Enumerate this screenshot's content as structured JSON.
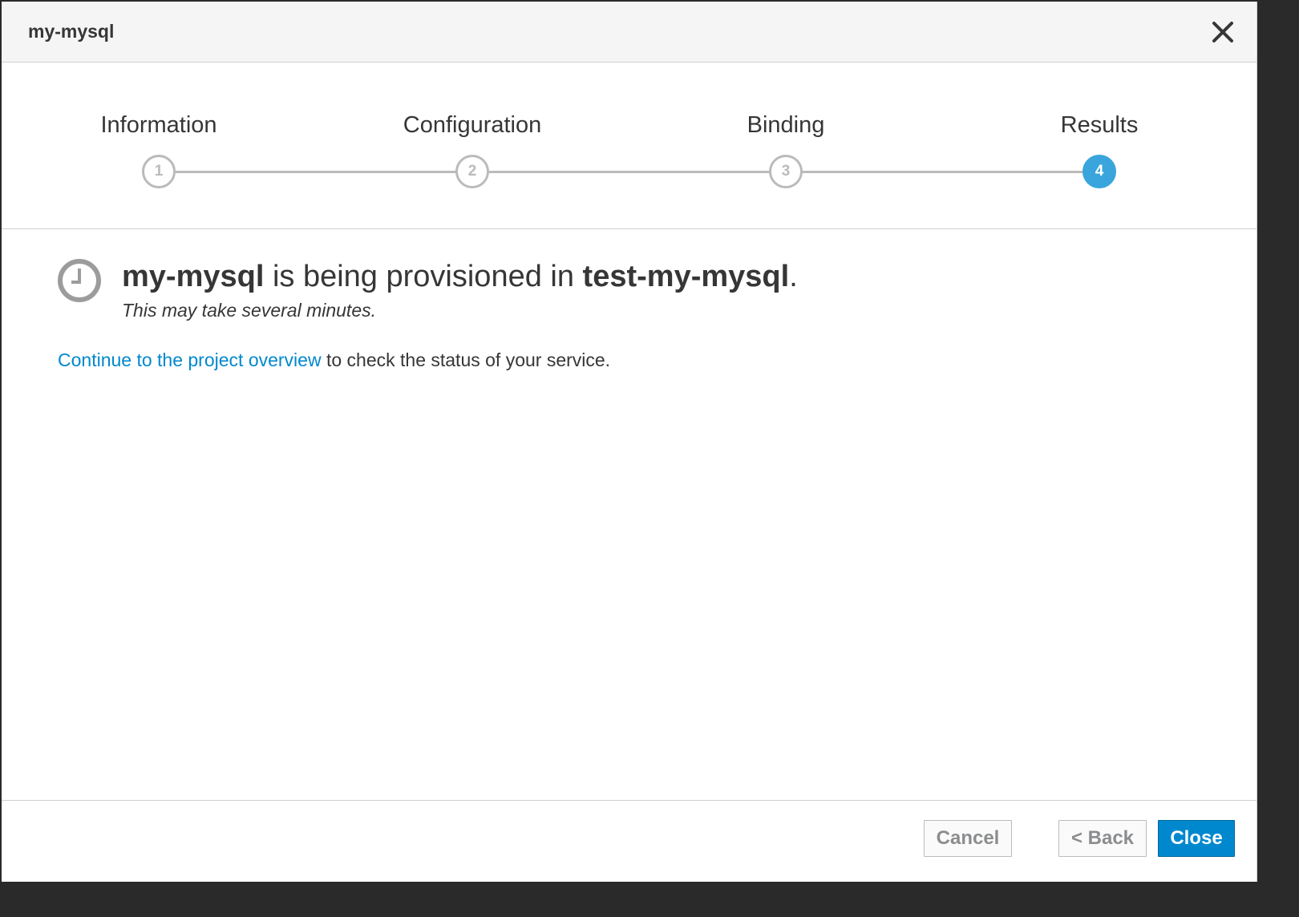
{
  "modal": {
    "title": "my-mysql",
    "close_icon": "close-icon"
  },
  "wizard": {
    "steps": [
      {
        "label": "Information",
        "number": "1",
        "active": false
      },
      {
        "label": "Configuration",
        "number": "2",
        "active": false
      },
      {
        "label": "Binding",
        "number": "3",
        "active": false
      },
      {
        "label": "Results",
        "number": "4",
        "active": true
      }
    ]
  },
  "result": {
    "icon": "clock-icon",
    "service_name": "my-mysql",
    "middle_text": " is being provisioned in ",
    "project_name": "test-my-mysql",
    "period": ".",
    "subtitle": "This may take several minutes.",
    "link_text": "Continue to the project overview",
    "after_link_text": " to check the status of your service."
  },
  "footer": {
    "cancel_label": "Cancel",
    "back_label": "< Back",
    "close_label": "Close"
  },
  "colors": {
    "accent": "#39a5dc",
    "link": "#0088ce",
    "primary_button": "#0088ce"
  }
}
